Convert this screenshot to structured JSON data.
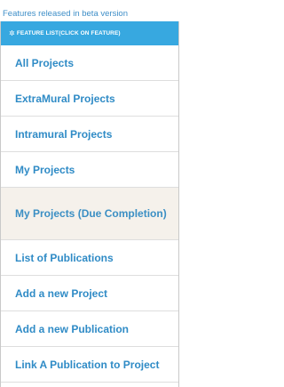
{
  "beta_note": "Features released in beta version",
  "header": {
    "icon": "gear-icon",
    "title": "FEATURE LIST(CLICK ON FEATURE)"
  },
  "menu": [
    {
      "label": "All Projects"
    },
    {
      "label": "ExtraMural Projects"
    },
    {
      "label": "Intramural Projects"
    },
    {
      "label": "My Projects"
    },
    {
      "label": "My Projects (Due Completion)"
    },
    {
      "label": "List of Publications"
    },
    {
      "label": "Add a new Project"
    },
    {
      "label": "Add a new Publication"
    },
    {
      "label": "Link A Publication to Project"
    }
  ],
  "colors": {
    "accent": "#37a8e0",
    "link": "#2f8bc6",
    "active_bg": "#f5f1eb"
  }
}
